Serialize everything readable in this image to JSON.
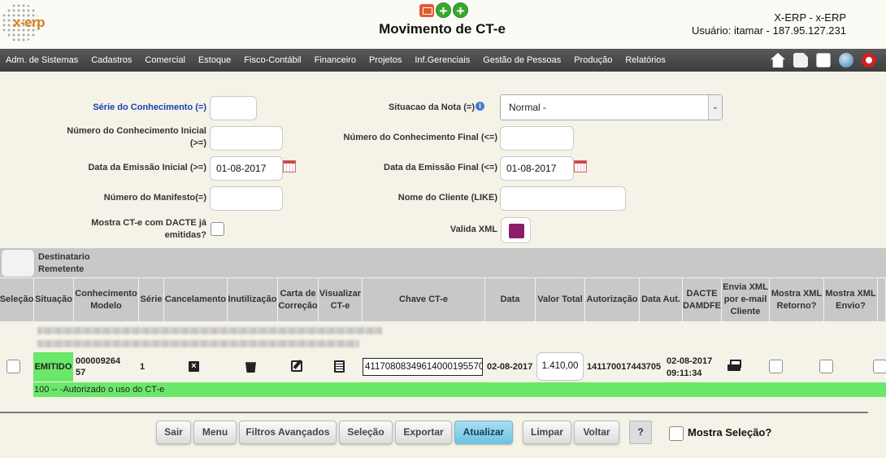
{
  "header": {
    "logo_text": "x-erp",
    "title": "Movimento de CT-e",
    "system": "X-ERP - x-ERP",
    "user": "Usuário: itamar - 187.95.127.231"
  },
  "menu": [
    "Adm. de Sistemas",
    "Cadastros",
    "Comercial",
    "Estoque",
    "Fisco-Contábil",
    "Financeiro",
    "Projetos",
    "Inf.Gerenciais",
    "Gestão de Pessoas",
    "Produção",
    "Relatórios"
  ],
  "filters": {
    "serie_label": "Série do Conhecimento (=)",
    "serie_value": "",
    "situacao_label": "Situacao da Nota (=)",
    "situacao_value": "Normal -",
    "numero_inicial_label": "Número do Conhecimento Inicial (>=)",
    "numero_inicial_value": "",
    "numero_final_label": "Número do Conhecimento Final (<=)",
    "numero_final_value": "",
    "data_inicial_label": "Data da Emissão Inicial (>=)",
    "data_inicial_value": "01-08-2017",
    "data_final_label": "Data da Emissão Final (<=)",
    "data_final_value": "01-08-2017",
    "manifesto_label": "Número do Manifesto(=)",
    "manifesto_value": "",
    "cliente_label": "Nome do Cliente (LIKE)",
    "cliente_value": "",
    "mostra_dacte_label": "Mostra CT-e com DACTE já emitidas?",
    "valida_xml_label": "Valida XML"
  },
  "grid": {
    "group_line1": "Destinatario",
    "group_line2": "Remetente",
    "columns": [
      {
        "l1": "Seleção",
        "l2": "",
        "l3": ""
      },
      {
        "l1": "Situação",
        "l2": "",
        "l3": ""
      },
      {
        "l1": "Conhecimento",
        "l2": "Modelo",
        "l3": ""
      },
      {
        "l1": "Série",
        "l2": "",
        "l3": ""
      },
      {
        "l1": "Cancelamento",
        "l2": "",
        "l3": ""
      },
      {
        "l1": "Inutilização",
        "l2": "",
        "l3": ""
      },
      {
        "l1": "Carta de",
        "l2": "Correção",
        "l3": ""
      },
      {
        "l1": "Visualizar",
        "l2": "CT-e",
        "l3": ""
      },
      {
        "l1": "Chave CT-e",
        "l2": "",
        "l3": ""
      },
      {
        "l1": "Data",
        "l2": "",
        "l3": ""
      },
      {
        "l1": "Valor Total",
        "l2": "",
        "l3": ""
      },
      {
        "l1": "Autorização",
        "l2": "",
        "l3": ""
      },
      {
        "l1": "Data Aut.",
        "l2": "",
        "l3": ""
      },
      {
        "l1": "DACTE",
        "l2": "DAMDFE",
        "l3": ""
      },
      {
        "l1": "Envia XML",
        "l2": "por e-mail",
        "l3": "Cliente"
      },
      {
        "l1": "Mostra XML",
        "l2": "Retorno?",
        "l3": ""
      },
      {
        "l1": "Mostra XML",
        "l2": "Envio?",
        "l3": ""
      }
    ],
    "row": {
      "situacao": "EMITIDO",
      "conhecimento": "000009264",
      "modelo": "57",
      "serie": "1",
      "chave": "41170808349614000195570",
      "data": "02-08-2017",
      "valor": "1.410,00",
      "autorizacao": "141170017443705",
      "data_aut_date": "02-08-2017",
      "data_aut_time": "09:11:34",
      "message": "100 -- -Autorizado o uso do CT-e"
    }
  },
  "buttons": {
    "sair": "Sair",
    "menu": "Menu",
    "filtros": "Filtros Avançados",
    "selecao": "Seleção",
    "exportar": "Exportar",
    "atualizar": "Atualizar",
    "limpar": "Limpar",
    "voltar": "Voltar",
    "help": "?",
    "mostra_selecao": "Mostra Seleção?"
  },
  "colors": {
    "status_green": "#6ae86a",
    "menubar": "#4a4a4a",
    "atualizar": "#8ad3ea",
    "label_blue": "#1a3fb0"
  }
}
